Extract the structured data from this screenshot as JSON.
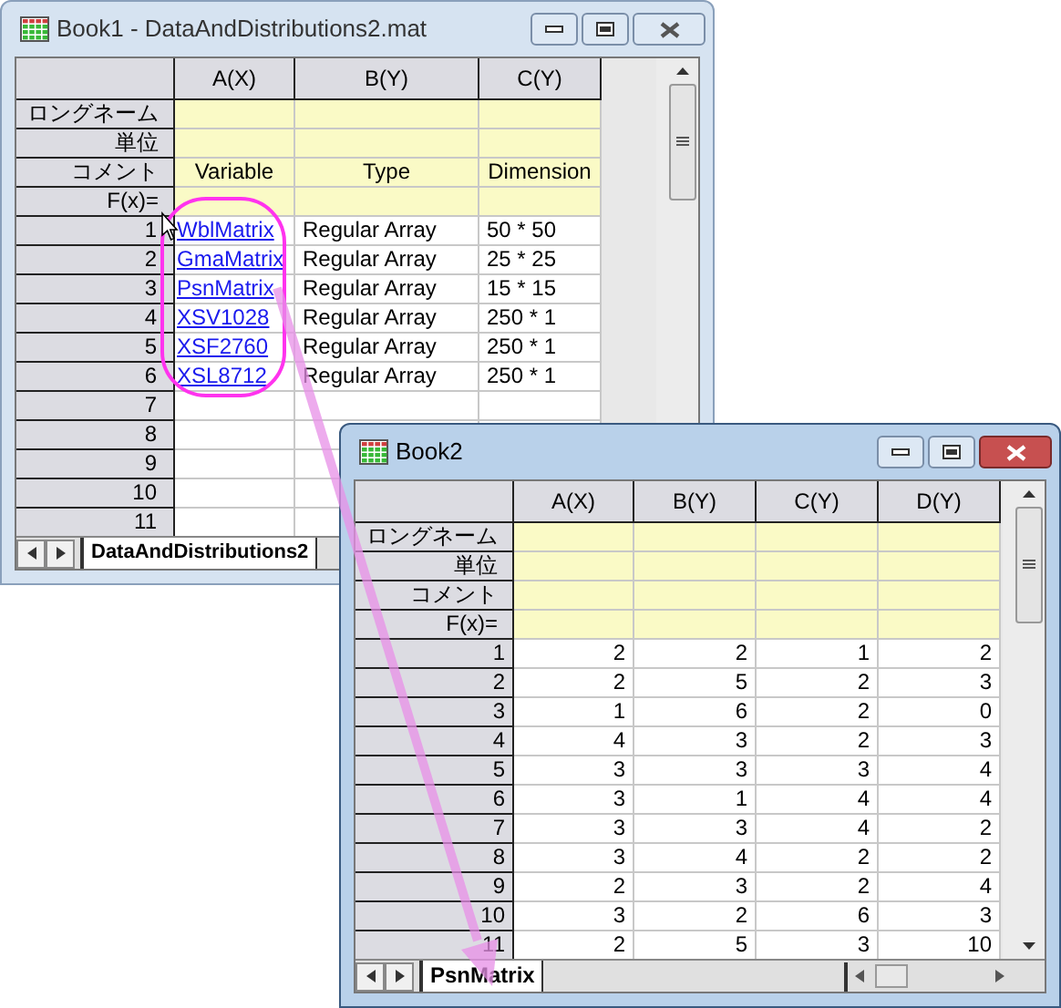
{
  "windows": [
    {
      "title": "Book1 - DataAndDistributions2.mat",
      "active": false,
      "sheet_tab": "DataAndDistributions2",
      "columns": [
        {
          "label": "A(X)",
          "kind": "link"
        },
        {
          "label": "B(Y)",
          "kind": "text"
        },
        {
          "label": "C(Y)",
          "kind": "text"
        }
      ],
      "label_rows": [
        {
          "label": "ロングネーム"
        },
        {
          "label": "単位"
        },
        {
          "label": "コメント",
          "cells": [
            "Variable",
            "Type",
            "Dimension"
          ]
        },
        {
          "label": "F(x)="
        }
      ],
      "rows": [
        {
          "number": "1",
          "cells": [
            "WblMatrix",
            "Regular Array",
            "50 * 50"
          ]
        },
        {
          "number": "2",
          "cells": [
            "GmaMatrix",
            "Regular Array",
            "25 * 25"
          ]
        },
        {
          "number": "3",
          "cells": [
            "PsnMatrix",
            "Regular Array",
            "15 * 15"
          ]
        },
        {
          "number": "4",
          "cells": [
            "XSV1028",
            "Regular Array",
            "250 * 1"
          ]
        },
        {
          "number": "5",
          "cells": [
            "XSF2760",
            "Regular Array",
            "250 * 1"
          ]
        },
        {
          "number": "6",
          "cells": [
            "XSL8712",
            "Regular Array",
            "250 * 1"
          ]
        },
        {
          "number": "7"
        },
        {
          "number": "8"
        },
        {
          "number": "9"
        },
        {
          "number": "10"
        },
        {
          "number": "11"
        }
      ]
    },
    {
      "title": "Book2",
      "active": true,
      "sheet_tab": "PsnMatrix",
      "columns": [
        {
          "label": "A(X)",
          "kind": "number"
        },
        {
          "label": "B(Y)",
          "kind": "number"
        },
        {
          "label": "C(Y)",
          "kind": "number"
        },
        {
          "label": "D(Y)",
          "kind": "number"
        }
      ],
      "label_rows": [
        {
          "label": "ロングネーム"
        },
        {
          "label": "単位"
        },
        {
          "label": "コメント"
        },
        {
          "label": "F(x)="
        }
      ],
      "rows": [
        {
          "number": "1",
          "cells": [
            "2",
            "2",
            "1",
            "2"
          ]
        },
        {
          "number": "2",
          "cells": [
            "2",
            "5",
            "2",
            "3"
          ]
        },
        {
          "number": "3",
          "cells": [
            "1",
            "6",
            "2",
            "0"
          ]
        },
        {
          "number": "4",
          "cells": [
            "4",
            "3",
            "2",
            "3"
          ]
        },
        {
          "number": "5",
          "cells": [
            "3",
            "3",
            "3",
            "4"
          ]
        },
        {
          "number": "6",
          "cells": [
            "3",
            "1",
            "4",
            "4"
          ]
        },
        {
          "number": "7",
          "cells": [
            "3",
            "3",
            "4",
            "2"
          ]
        },
        {
          "number": "8",
          "cells": [
            "3",
            "4",
            "2",
            "2"
          ]
        },
        {
          "number": "9",
          "cells": [
            "2",
            "3",
            "2",
            "4"
          ]
        },
        {
          "number": "10",
          "cells": [
            "3",
            "2",
            "6",
            "3"
          ]
        },
        {
          "number": "11",
          "cells": [
            "2",
            "5",
            "3",
            "10"
          ]
        }
      ]
    }
  ]
}
